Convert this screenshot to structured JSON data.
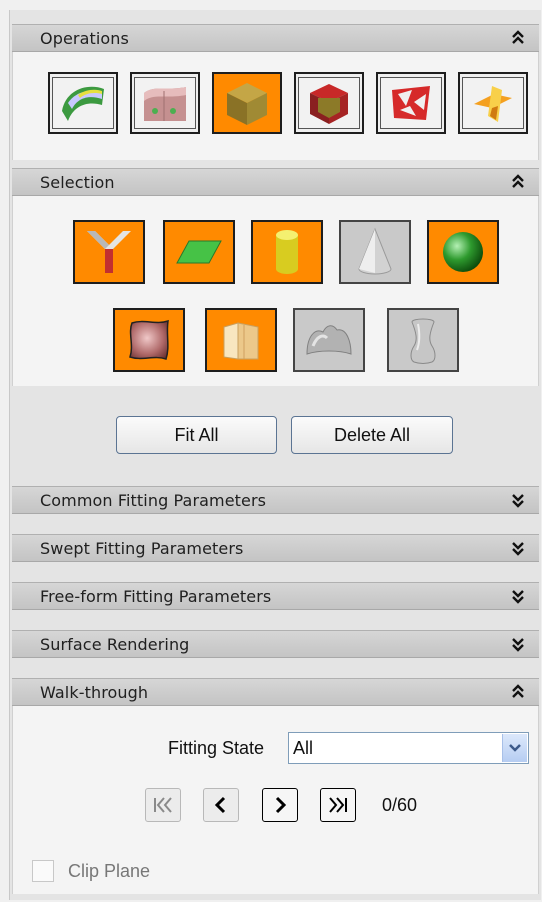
{
  "sections": {
    "operations": {
      "title": "Operations"
    },
    "selection": {
      "title": "Selection"
    },
    "common": {
      "title": "Common Fitting Parameters"
    },
    "swept": {
      "title": "Swept Fitting Parameters"
    },
    "freeform": {
      "title": "Free-form Fitting Parameters"
    },
    "rendering": {
      "title": "Surface Rendering"
    },
    "walk": {
      "title": "Walk-through"
    }
  },
  "actions": {
    "fit_all": "Fit All",
    "delete_all": "Delete All"
  },
  "walk": {
    "fitting_state_label": "Fitting State",
    "fitting_state_value": "All",
    "counter": "0/60",
    "clip_plane_label": "Clip Plane",
    "clip_plane_checked": false
  },
  "operations_icons": [
    {
      "name": "surface-segment-icon",
      "state": "normal"
    },
    {
      "name": "region-mesh-icon",
      "state": "normal"
    },
    {
      "name": "cube-fit-icon",
      "state": "active"
    },
    {
      "name": "cube-red-icon",
      "state": "normal"
    },
    {
      "name": "freeform-patch-icon",
      "state": "normal"
    },
    {
      "name": "trim-planes-icon",
      "state": "normal"
    }
  ],
  "selection_icons": [
    {
      "name": "y-junction-icon",
      "state": "active"
    },
    {
      "name": "plane-icon",
      "state": "active"
    },
    {
      "name": "cylinder-icon",
      "state": "active"
    },
    {
      "name": "cone-icon",
      "state": "inactive"
    },
    {
      "name": "sphere-icon",
      "state": "active"
    },
    {
      "name": "freeform-surface-icon",
      "state": "active"
    },
    {
      "name": "swept-surface-icon",
      "state": "active"
    },
    {
      "name": "blob-surface-icon",
      "state": "inactive"
    },
    {
      "name": "revolved-surface-icon",
      "state": "inactive"
    }
  ],
  "colors": {
    "active": "#ff8a00",
    "inactive": "#c9c9c9",
    "header": "#cacaca"
  }
}
